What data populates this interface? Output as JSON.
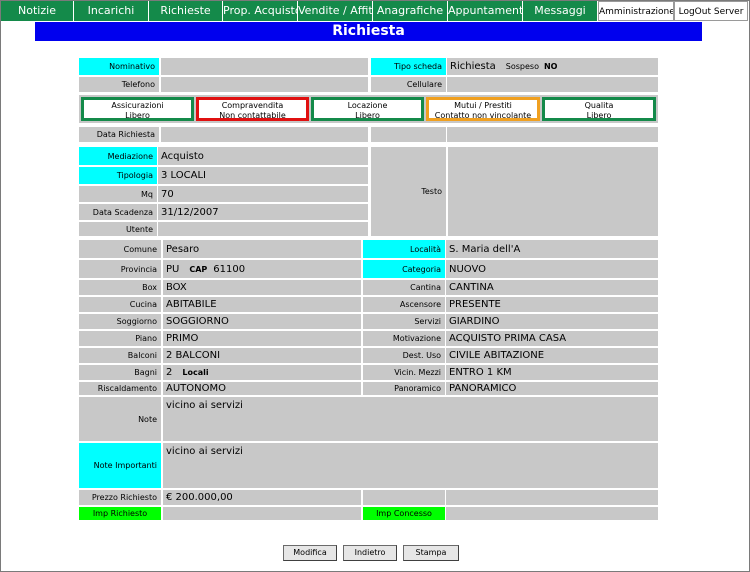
{
  "nav": {
    "tabs": [
      "Notizie",
      "Incarichi",
      "Richieste",
      "Prop. Acquisto",
      "Vendite / Affitti",
      "Anagrafiche",
      "Appuntamenti",
      "Messaggi"
    ],
    "admin": "Amministrazione",
    "logout": "LogOut",
    "server": "Server"
  },
  "page_title": "Richiesta",
  "header": {
    "nominativo_label": "Nominativo",
    "nominativo_value": "",
    "tipo_scheda_label": "Tipo scheda",
    "tipo_scheda_value": "Richiesta",
    "sospeso_label": "Sospeso",
    "sospeso_value": "NO",
    "telefono_label": "Telefono",
    "telefono_value": "",
    "cellulare_label": "Cellulare",
    "cellulare_value": ""
  },
  "statuses": [
    {
      "title": "Assicurazioni",
      "state": "Libero"
    },
    {
      "title": "Compravendita",
      "state": "Non contattabile"
    },
    {
      "title": "Locazione",
      "state": "Libero"
    },
    {
      "title": "Mutui / Prestiti",
      "state": "Contatto non vincolante"
    },
    {
      "title": "Qualita",
      "state": "Libero"
    }
  ],
  "status_colors": {
    "green": "#148a4a",
    "red": "#e01010",
    "orange": "#f0a020"
  },
  "request": {
    "data_richiesta_label": "Data Richiesta",
    "mediazione_label": "Mediazione",
    "mediazione_value": "Acquisto",
    "tipologia_label": "Tipologia",
    "tipologia_value": "3 LOCALI",
    "mq_label": "Mq",
    "mq_value": "70",
    "data_scadenza_label": "Data Scadenza",
    "data_scadenza_value": "31/12/2007",
    "utente_label": "Utente",
    "utente_value": "",
    "testo_label": "Testo",
    "testo_value": ""
  },
  "details": {
    "comune_label": "Comune",
    "comune_value": "Pesaro",
    "localita_label": "Località",
    "localita_value": "S. Maria dell'A",
    "provincia_label": "Provincia",
    "provincia_value": "PU",
    "cap_label": "CAP",
    "cap_value": "61100",
    "categoria_label": "Categoria",
    "categoria_value": "NUOVO",
    "box_label": "Box",
    "box_value": "BOX",
    "cantina_label": "Cantina",
    "cantina_value": "CANTINA",
    "cucina_label": "Cucina",
    "cucina_value": "ABITABILE",
    "ascensore_label": "Ascensore",
    "ascensore_value": "PRESENTE",
    "soggiorno_label": "Soggiorno",
    "soggiorno_value": "SOGGIORNO",
    "servizi_label": "Servizi",
    "servizi_value": "GIARDINO",
    "piano_label": "Piano",
    "piano_value": "PRIMO",
    "motivazione_label": "Motivazione",
    "motivazione_value": "ACQUISTO PRIMA CASA",
    "balconi_label": "Balconi",
    "balconi_value": "2 BALCONI",
    "dest_uso_label": "Dest. Uso",
    "dest_uso_value": "CIVILE ABITAZIONE",
    "bagni_label": "Bagni",
    "bagni_value": "2",
    "bagni_unit": "Locali",
    "vicin_mezzi_label": "Vicin. Mezzi",
    "vicin_mezzi_value": "ENTRO 1 KM",
    "riscaldamento_label": "Riscaldamento",
    "riscaldamento_value": "AUTONOMO",
    "panoramico_label": "Panoramico",
    "panoramico_value": "PANORAMICO",
    "note_label": "Note",
    "note_value": "vicino ai servizi",
    "note_importanti_label": "Note Importanti",
    "note_importanti_value": "vicino ai servizi",
    "prezzo_label": "Prezzo Richiesto",
    "prezzo_value": "€ 200.000,00",
    "imp_richiesto_label": "Imp Richiesto",
    "imp_richiesto_value": "",
    "imp_concesso_label": "Imp Concesso",
    "imp_concesso_value": ""
  },
  "buttons": {
    "modifica": "Modifica",
    "indietro": "Indietro",
    "stampa": "Stampa"
  }
}
